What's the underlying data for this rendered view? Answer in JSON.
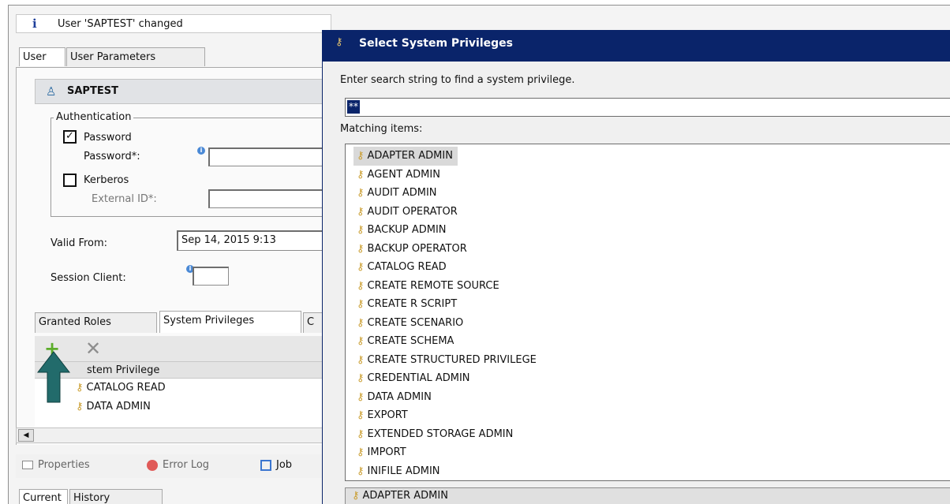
{
  "info": {
    "icon": "info-icon",
    "message": "User 'SAPTEST' changed"
  },
  "tabs": {
    "user": "User",
    "user_parameters": "User Parameters"
  },
  "user": {
    "icon": "user-icon",
    "name": "SAPTEST"
  },
  "auth": {
    "legend": "Authentication",
    "password_checked": true,
    "password_label": "Password",
    "password_field_label": "Password*:",
    "kerberos_checked": false,
    "kerberos_label": "Kerberos",
    "external_id_label": "External ID*:"
  },
  "valid_from": {
    "label": "Valid From:",
    "value": "Sep 14, 2015 9:13"
  },
  "session_client": {
    "label": "Session Client:"
  },
  "priv_tabs": {
    "granted_roles": "Granted Roles",
    "system_privileges": "System Privileges",
    "third_tab_partial": "C"
  },
  "priv_list": {
    "header": "stem Privilege",
    "items": [
      "CATALOG READ",
      "DATA ADMIN"
    ]
  },
  "bottom_tabs": {
    "properties": "Properties",
    "error_log": "Error Log",
    "job": "Job"
  },
  "history_tabs": {
    "current": "Current",
    "history": "History"
  },
  "dialog": {
    "title": "Select System Privileges",
    "instruction": "Enter search string to find a system privilege.",
    "search_value": "**",
    "matching_label": "Matching items:",
    "items": [
      "ADAPTER ADMIN",
      "AGENT ADMIN",
      "AUDIT ADMIN",
      "AUDIT OPERATOR",
      "BACKUP ADMIN",
      "BACKUP OPERATOR",
      "CATALOG READ",
      "CREATE REMOTE SOURCE",
      "CREATE R SCRIPT",
      "CREATE SCENARIO",
      "CREATE SCHEMA",
      "CREATE STRUCTURED PRIVILEGE",
      "CREDENTIAL ADMIN",
      "DATA ADMIN",
      "EXPORT",
      "EXTENDED STORAGE ADMIN",
      "IMPORT",
      "INIFILE ADMIN"
    ],
    "selected_index": 0,
    "status_text": "ADAPTER ADMIN"
  }
}
